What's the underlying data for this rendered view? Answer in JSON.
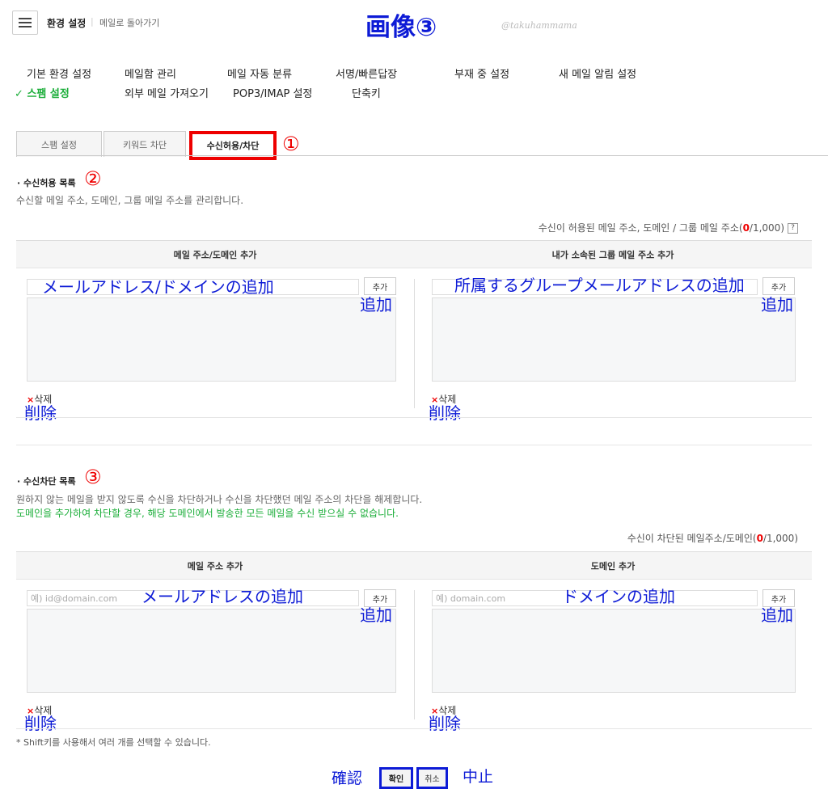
{
  "header": {
    "title": "환경 설정",
    "separator": "|",
    "back_link": "메일로 돌아가기",
    "annotation_title": "画像③",
    "watermark": "@takuhammama"
  },
  "nav": {
    "row1": [
      "기본 환경 설정",
      "메일함 관리",
      "메일 자동 분류",
      "서명/빠른답장",
      "부재 중 설정",
      "새 메일 알림 설정"
    ],
    "row2": [
      "스팸 설정",
      "외부 메일 가져오기",
      "POP3/IMAP 설정",
      "단축키"
    ],
    "active_check": "✓"
  },
  "tabs": {
    "items": [
      "스팸 설정",
      "키워드 차단",
      "수신허용/차단"
    ],
    "active_index": 2,
    "annotation": "①"
  },
  "allow": {
    "title": "수신허용 목록",
    "annotation": "②",
    "desc": "수신할 메일 주소, 도메인, 그룹 메일 주소를 관리합니다.",
    "count_prefix": "수신이 허용된 메일 주소, 도메인 / 그룹 메일 주소(",
    "count_value": "0",
    "count_suffix": "/1,000)",
    "help": "?",
    "col_left": "메일 주소/도메인 추가",
    "col_right": "내가 소속된 그룹 메일 주소 추가",
    "add_label": "추가",
    "delete_label": "삭제",
    "delete_x": "×",
    "ann_left_input": "メールアドレス/ドメインの追加",
    "ann_right_input": "所属するグループメールアドレスの追加",
    "ann_add": "追加",
    "ann_delete": "削除"
  },
  "block": {
    "title": "수신차단 목록",
    "annotation": "③",
    "desc": "원하지 않는 메일을 받지 않도록 수신을 차단하거나 수신을 차단했던 메일 주소의 차단을 해제합니다.",
    "desc_green": "도메인을 추가하여 차단할 경우, 해당 도메인에서 발송한 모든 메일을 수신 받으실 수 없습니다.",
    "count_prefix": "수신이 차단된 메일주소/도메인(",
    "count_value": "0",
    "count_suffix": "/1,000)",
    "col_left": "메일 주소 추가",
    "col_right": "도메인 추가",
    "placeholder_left": "예) id@domain.com",
    "placeholder_right": "예) domain.com",
    "add_label": "추가",
    "delete_label": "삭제",
    "delete_x": "×",
    "ann_left_input": "メールアドレスの追加",
    "ann_right_input": "ドメインの追加",
    "ann_add": "追加",
    "ann_delete": "削除"
  },
  "footer": {
    "note": "* Shift키를 사용해서 여러 개를 선택할 수 있습니다.",
    "confirm": "확인",
    "cancel": "취소",
    "ann_confirm": "確認",
    "ann_cancel": "中止"
  },
  "colors": {
    "accent_green": "#1cae3a",
    "annotation_blue": "#0d1bd6",
    "highlight_red": "#ee0000"
  }
}
